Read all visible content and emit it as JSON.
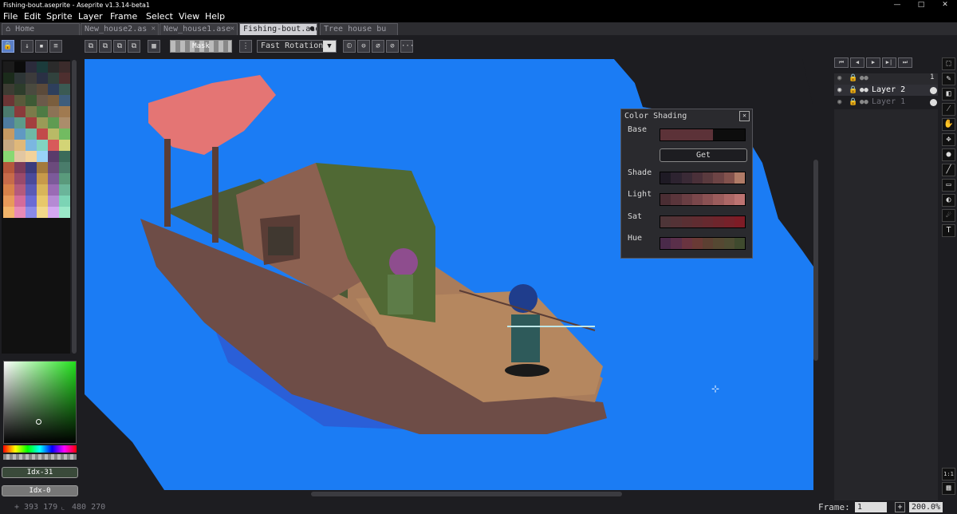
{
  "window": {
    "title": "Fishing-bout.aseprite - Aseprite v1.3.14-beta1",
    "minimize": "—",
    "maximize": "□",
    "close": "✕"
  },
  "menu": [
    "File",
    "Edit",
    "Sprite",
    "Layer",
    "Frame",
    "Select",
    "View",
    "Help"
  ],
  "tabs": [
    {
      "label": "Home",
      "icon": "home-icon"
    },
    {
      "label": "New_house2.as",
      "close": "✕"
    },
    {
      "label": "New_house1.ase",
      "close": "✕"
    },
    {
      "label": "Fishing-bout.ase",
      "close": "●"
    },
    {
      "label": "Tree house bu",
      "close": ""
    }
  ],
  "toolbar": {
    "mask_label": "Mask",
    "rotation_mode": "Fast Rotation",
    "more": "···"
  },
  "palette_colors": [
    "#1b1b1b",
    "#0b0b0b",
    "#2b2b3b",
    "#1b3b3b",
    "#2b2b2b",
    "#3b2b2b",
    "#1b2b1b",
    "#2d3536",
    "#3c3b3b",
    "#2a3044",
    "#31423d",
    "#4e2f2f",
    "#3d3c33",
    "#2d3d2b",
    "#4a4a3f",
    "#5b4a3a",
    "#2e3f5c",
    "#3b5a53",
    "#6b3535",
    "#5a5a3b",
    "#3d5a35",
    "#6b5a4a",
    "#7a5e3d",
    "#3e5d7c",
    "#4c7b6e",
    "#8a3b3b",
    "#7b7b4a",
    "#4e7b44",
    "#8c7356",
    "#a07a50",
    "#4f7ca0",
    "#5d9b8a",
    "#a33f3f",
    "#9a9b57",
    "#5f9b52",
    "#ab8d6b",
    "#c69a63",
    "#6099c2",
    "#6fb8a6",
    "#c24a4a",
    "#b9ba66",
    "#72bb61",
    "#c7a983",
    "#e0b87a",
    "#7bb7e0",
    "#82d4c1",
    "#d85a5a",
    "#d3d476",
    "#88d872",
    "#e2c7a2",
    "#f2d29a",
    "#98d2f7",
    "#5a3b6b",
    "#3b6b5a",
    "#b5573b",
    "#7c3b5a",
    "#3b3b7c",
    "#a37a3b",
    "#6b4a7c",
    "#4a7c6b",
    "#c76b4a",
    "#9a4a6b",
    "#4a4a9a",
    "#c79a4a",
    "#7c5a9a",
    "#5a9a7c",
    "#d8824a",
    "#b55a7c",
    "#5a5ab5",
    "#d8b55a",
    "#9a6bb5",
    "#6bb59a",
    "#e89a5a",
    "#d46b9a",
    "#6b6bd4",
    "#e8c86b",
    "#b58ad4",
    "#7cd4b5",
    "#f2b56b",
    "#e88ab5",
    "#8a8ae8",
    "#f2d88a",
    "#d4a8f2",
    "#9ae8c8"
  ],
  "picker": {
    "index_main": "Idx-31",
    "index_bg": "Idx-0"
  },
  "shading": {
    "title": "Color Shading",
    "close": "✕",
    "base_label": "Base",
    "get_label": "Get",
    "shade_label": "Shade",
    "light_label": "Light",
    "sat_label": "Sat",
    "hue_label": "Hue",
    "base": [
      "#5c3238",
      "#5c3238",
      "#5c3238",
      "#5c3238",
      "#5c3238",
      "#0d0d0d",
      "#0d0d0d",
      "#0d0d0d"
    ],
    "shade": [
      "#1e1a24",
      "#2d2330",
      "#3a2a36",
      "#4a3039",
      "#5a3a3e",
      "#6d4445",
      "#83524d",
      "#b07b67"
    ],
    "light": [
      "#4a2d33",
      "#5a353b",
      "#6a3e43",
      "#7a474b",
      "#8a5153",
      "#9b5c5c",
      "#ac6766",
      "#bc7371"
    ],
    "sat": [
      "#4e3538",
      "#543236",
      "#5a2f33",
      "#602c31",
      "#67292f",
      "#6e252c",
      "#76212a",
      "#7e1c26"
    ],
    "hue": [
      "#4a2a4a",
      "#5a2f4a",
      "#6a3440",
      "#6a3a35",
      "#5c4032",
      "#554832",
      "#4e4d33",
      "#3f4a2e"
    ]
  },
  "frames": {
    "first": "⏮",
    "prev": "◀",
    "play": "▶",
    "next": "▶|",
    "last": "⏭",
    "current": "1"
  },
  "layers": [
    {
      "name": "Layer 2"
    },
    {
      "name": "Layer 1"
    }
  ],
  "tools": [
    "marquee",
    "pencil",
    "eraser",
    "eyedropper",
    "hand",
    "move",
    "bucket",
    "line",
    "rectangle",
    "blur",
    "smudge",
    "text"
  ],
  "tool_glyphs": [
    "⬚",
    "✎",
    "◧",
    "⁄",
    "✋",
    "✥",
    "●",
    "╱",
    "▭",
    "◐",
    "☄",
    "T"
  ],
  "bottom_tools": [
    "1:1",
    "▦"
  ],
  "status": {
    "coords": "393 179",
    "size": "480 270",
    "frame_label": "Frame:",
    "frame_value": "1",
    "add": "+",
    "zoom": "200.0%"
  }
}
